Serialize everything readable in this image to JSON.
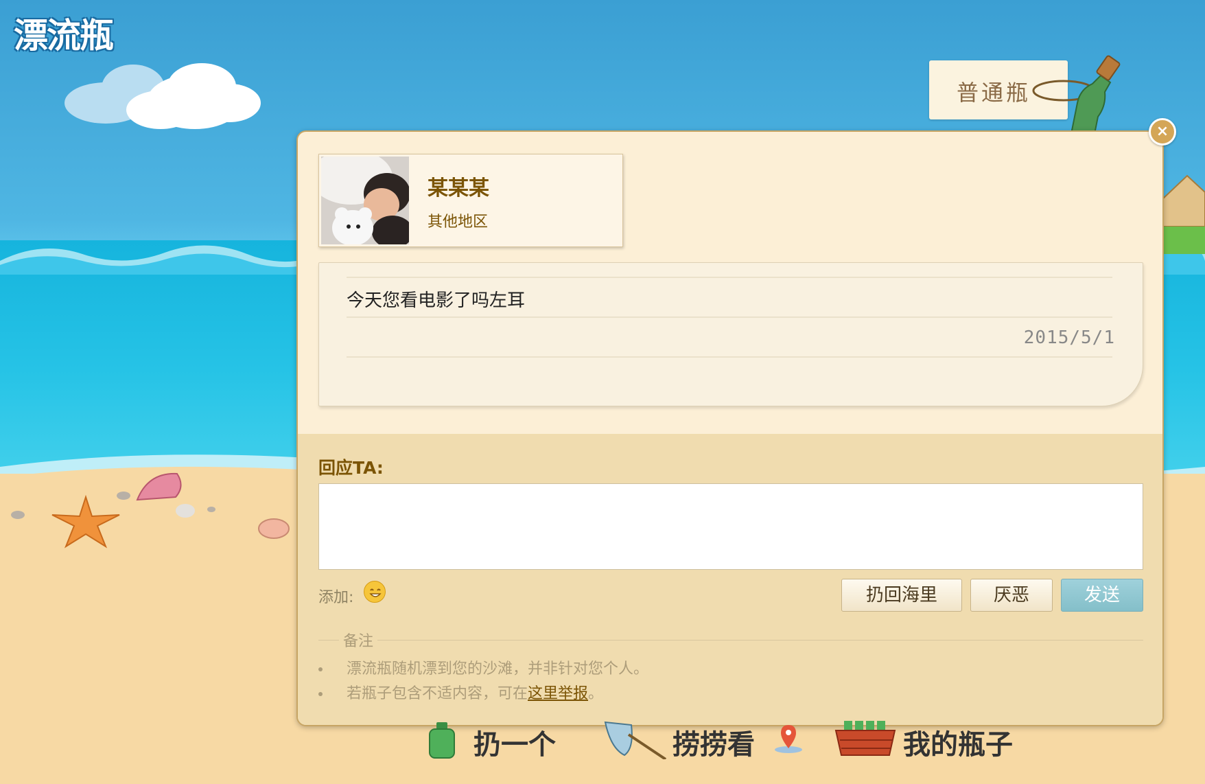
{
  "app": {
    "logo_text": "漂流瓶"
  },
  "bottle_tab": {
    "label": "普通瓶"
  },
  "dialog": {
    "close_label": "×",
    "profile": {
      "name": "某某某",
      "region": "其他地区"
    },
    "message": {
      "text": "今天您看电影了吗左耳",
      "date": "2015/5/1"
    },
    "reply": {
      "label": "回应TA:",
      "input_value": "",
      "add_label": "添加:"
    },
    "buttons": {
      "throw_back": "扔回海里",
      "hate": "厌恶",
      "send": "发送"
    },
    "notes": {
      "title": "备注",
      "note1": "漂流瓶随机漂到您的沙滩，并非针对您个人。",
      "note2_prefix": "若瓶子包含不适内容，可在",
      "note2_link": "这里举报",
      "note2_suffix": "。"
    }
  },
  "bottom_nav": {
    "throw": "扔一个",
    "fish": "捞捞看",
    "mine": "我的瓶子"
  },
  "colors": {
    "accent": "#7b5405",
    "dialog_bg": "#fcefd6",
    "send_btn": "#84bfc9"
  },
  "icons": [
    "close-icon",
    "emoji-icon",
    "bottle-icon",
    "net-icon",
    "location-pin-icon",
    "basket-icon"
  ]
}
